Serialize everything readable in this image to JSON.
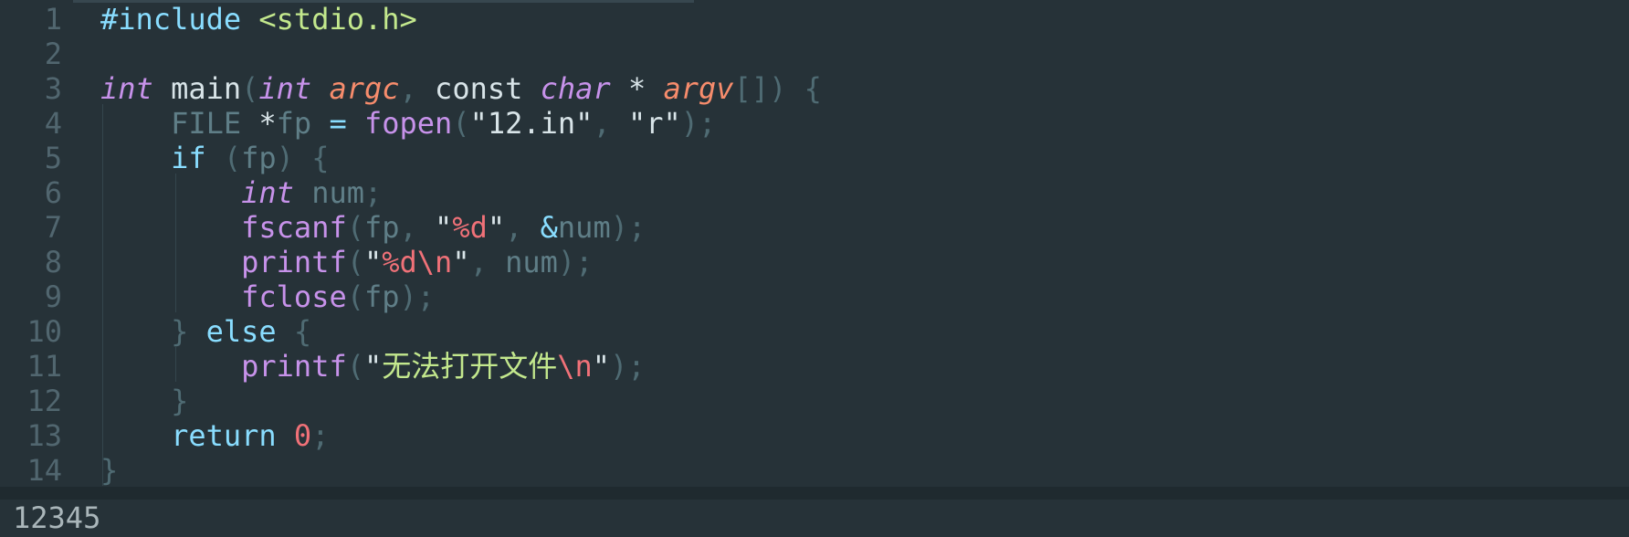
{
  "editor": {
    "line_numbers": [
      "1",
      "2",
      "3",
      "4",
      "5",
      "6",
      "7",
      "8",
      "9",
      "10",
      "11",
      "12",
      "13",
      "14"
    ],
    "lines": [
      [
        {
          "t": "#include",
          "c": "pp"
        },
        {
          "t": " ",
          "c": "ks"
        },
        {
          "t": "<stdio.h>",
          "c": "hdr"
        }
      ],
      [],
      [
        {
          "t": "int",
          "c": "typ"
        },
        {
          "t": " ",
          "c": "ks"
        },
        {
          "t": "main",
          "c": "ks"
        },
        {
          "t": "(",
          "c": "pun"
        },
        {
          "t": "int",
          "c": "typ"
        },
        {
          "t": " ",
          "c": "ks"
        },
        {
          "t": "argc",
          "c": "prm"
        },
        {
          "t": ", ",
          "c": "pun"
        },
        {
          "t": "const",
          "c": "ks"
        },
        {
          "t": " ",
          "c": "ks"
        },
        {
          "t": "char",
          "c": "typ"
        },
        {
          "t": " ",
          "c": "ks"
        },
        {
          "t": "*",
          "c": "ks"
        },
        {
          "t": " ",
          "c": "ks"
        },
        {
          "t": "argv",
          "c": "prm"
        },
        {
          "t": "[]) {",
          "c": "pun"
        }
      ],
      [
        {
          "t": "    ",
          "c": "ks"
        },
        {
          "t": "FILE",
          "c": "var"
        },
        {
          "t": " ",
          "c": "ks"
        },
        {
          "t": "*",
          "c": "ks"
        },
        {
          "t": "fp",
          "c": "var"
        },
        {
          "t": " ",
          "c": "ks"
        },
        {
          "t": "=",
          "c": "op"
        },
        {
          "t": " ",
          "c": "ks"
        },
        {
          "t": "fopen",
          "c": "fn"
        },
        {
          "t": "(",
          "c": "pun"
        },
        {
          "t": "\"12.in\"",
          "c": "ks"
        },
        {
          "t": ", ",
          "c": "pun"
        },
        {
          "t": "\"r\"",
          "c": "ks"
        },
        {
          "t": ");",
          "c": "pun"
        }
      ],
      [
        {
          "t": "    ",
          "c": "ks"
        },
        {
          "t": "if",
          "c": "kw"
        },
        {
          "t": " (",
          "c": "pun"
        },
        {
          "t": "fp",
          "c": "var"
        },
        {
          "t": ") {",
          "c": "pun"
        }
      ],
      [
        {
          "t": "        ",
          "c": "ks"
        },
        {
          "t": "int",
          "c": "typ"
        },
        {
          "t": " ",
          "c": "ks"
        },
        {
          "t": "num",
          "c": "var"
        },
        {
          "t": ";",
          "c": "pun"
        }
      ],
      [
        {
          "t": "        ",
          "c": "ks"
        },
        {
          "t": "fscanf",
          "c": "fn"
        },
        {
          "t": "(",
          "c": "pun"
        },
        {
          "t": "fp",
          "c": "var"
        },
        {
          "t": ", ",
          "c": "pun"
        },
        {
          "t": "\"",
          "c": "ks"
        },
        {
          "t": "%d",
          "c": "esc"
        },
        {
          "t": "\"",
          "c": "ks"
        },
        {
          "t": ", ",
          "c": "pun"
        },
        {
          "t": "&",
          "c": "op"
        },
        {
          "t": "num",
          "c": "var"
        },
        {
          "t": ");",
          "c": "pun"
        }
      ],
      [
        {
          "t": "        ",
          "c": "ks"
        },
        {
          "t": "printf",
          "c": "fn"
        },
        {
          "t": "(",
          "c": "pun"
        },
        {
          "t": "\"",
          "c": "ks"
        },
        {
          "t": "%d\\n",
          "c": "esc"
        },
        {
          "t": "\"",
          "c": "ks"
        },
        {
          "t": ", ",
          "c": "pun"
        },
        {
          "t": "num",
          "c": "var"
        },
        {
          "t": ");",
          "c": "pun"
        }
      ],
      [
        {
          "t": "        ",
          "c": "ks"
        },
        {
          "t": "fclose",
          "c": "fn"
        },
        {
          "t": "(",
          "c": "pun"
        },
        {
          "t": "fp",
          "c": "var"
        },
        {
          "t": ");",
          "c": "pun"
        }
      ],
      [
        {
          "t": "    ",
          "c": "ks"
        },
        {
          "t": "}",
          "c": "pun"
        },
        {
          "t": " ",
          "c": "ks"
        },
        {
          "t": "else",
          "c": "kw"
        },
        {
          "t": " {",
          "c": "pun"
        }
      ],
      [
        {
          "t": "        ",
          "c": "ks"
        },
        {
          "t": "printf",
          "c": "fn"
        },
        {
          "t": "(",
          "c": "pun"
        },
        {
          "t": "\"",
          "c": "ks"
        },
        {
          "t": "无法打开文件",
          "c": "str"
        },
        {
          "t": "\\n",
          "c": "esc"
        },
        {
          "t": "\"",
          "c": "ks"
        },
        {
          "t": ");",
          "c": "pun"
        }
      ],
      [
        {
          "t": "    ",
          "c": "ks"
        },
        {
          "t": "}",
          "c": "pun"
        }
      ],
      [
        {
          "t": "    ",
          "c": "ks"
        },
        {
          "t": "return",
          "c": "kw"
        },
        {
          "t": " ",
          "c": "ks"
        },
        {
          "t": "0",
          "c": "num"
        },
        {
          "t": ";",
          "c": "pun"
        }
      ],
      [
        {
          "t": "}",
          "c": "pun"
        }
      ]
    ]
  },
  "output": {
    "text": "12345"
  }
}
